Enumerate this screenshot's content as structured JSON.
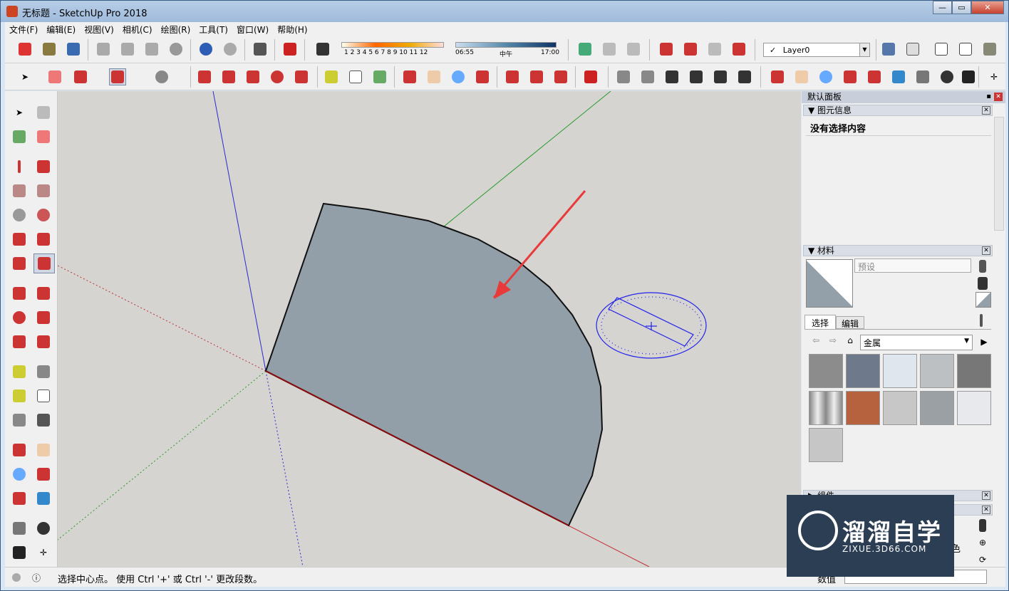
{
  "window": {
    "title": "无标题 - SketchUp Pro 2018"
  },
  "menu": [
    "文件(F)",
    "编辑(E)",
    "视图(V)",
    "相机(C)",
    "绘图(R)",
    "工具(T)",
    "窗口(W)",
    "帮助(H)"
  ],
  "shadow": {
    "months": "1 2 3 4 5 6 7 8 9 10 11 12",
    "time_start": "06:55",
    "time_mid": "中午",
    "time_end": "17:00"
  },
  "layer": {
    "check": "✓",
    "name": "Layer0"
  },
  "panel": {
    "title": "默认面板",
    "entity_info": {
      "header": "图元信息",
      "content": "没有选择内容"
    },
    "materials": {
      "header": "材料",
      "name_placeholder": "预设",
      "tabs": [
        "选择",
        "编辑"
      ],
      "library": "金属"
    },
    "components_header": "组件",
    "bottom_fragment": "色",
    "measure_label": "数值"
  },
  "status": {
    "text": "选择中心点。 使用 Ctrl '+' 或 Ctrl '-' 更改段数。"
  },
  "watermark": {
    "brand": "溜溜自学",
    "url": "ZIXUE.3D66.COM"
  },
  "colors": {
    "face": "#939fa8",
    "viewport": "#d5d4d0",
    "arrow": "#e83a3a",
    "protractor": "#2222ee"
  }
}
